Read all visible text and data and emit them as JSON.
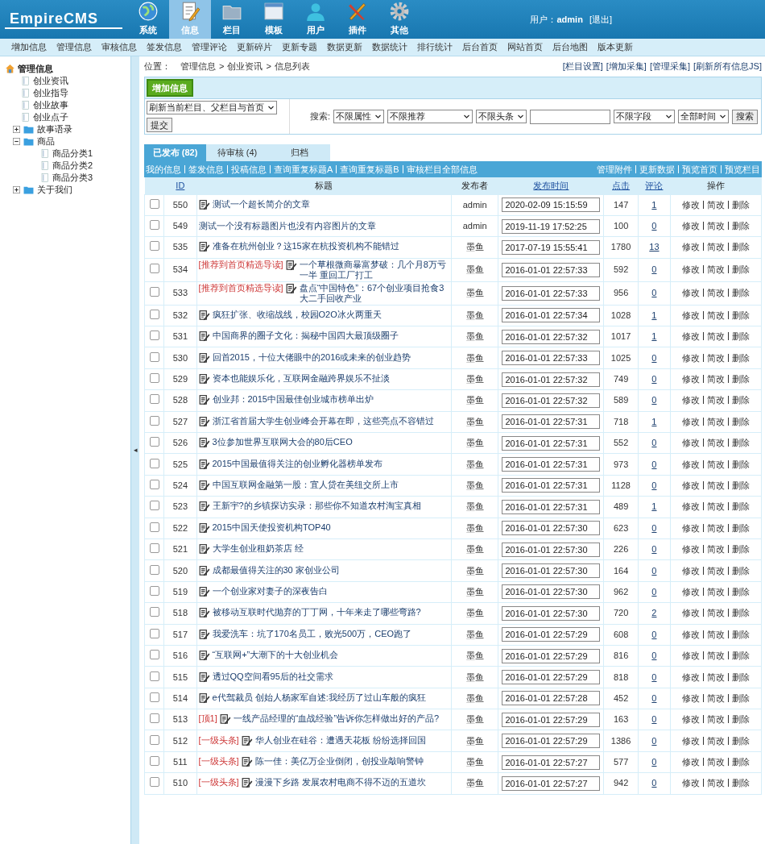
{
  "header": {
    "logo": "EmpireCMS",
    "nav": [
      {
        "label": "系统",
        "selected": false
      },
      {
        "label": "信息",
        "selected": true
      },
      {
        "label": "栏目",
        "selected": false
      },
      {
        "label": "模板",
        "selected": false
      },
      {
        "label": "用户",
        "selected": false
      },
      {
        "label": "插件",
        "selected": false
      },
      {
        "label": "其他",
        "selected": false
      }
    ],
    "user_label": "用户：",
    "user": "admin",
    "logout": "[退出]"
  },
  "submenu": [
    "增加信息",
    "管理信息",
    "审核信息",
    "签发信息",
    "管理评论",
    "更新碎片",
    "更新专题",
    "数据更新",
    "数据统计",
    "排行统计",
    "后台首页",
    "网站首页",
    "后台地图",
    "版本更新"
  ],
  "tree": {
    "label": "管理信息",
    "children": [
      {
        "label": "创业资讯",
        "kind": "page"
      },
      {
        "label": "创业指导",
        "kind": "page"
      },
      {
        "label": "创业故事",
        "kind": "page"
      },
      {
        "label": "创业点子",
        "kind": "page"
      },
      {
        "label": "故事语录",
        "kind": "folder",
        "expanded": false
      },
      {
        "label": "商品",
        "kind": "folder",
        "expanded": true,
        "children": [
          {
            "label": "商品分类1",
            "kind": "page"
          },
          {
            "label": "商品分类2",
            "kind": "page"
          },
          {
            "label": "商品分类3",
            "kind": "page"
          }
        ]
      },
      {
        "label": "关于我们",
        "kind": "folder",
        "expanded": false
      }
    ]
  },
  "splitter": "◂",
  "breadcrumb": {
    "label": "位置：",
    "links": [
      "管理信息",
      "创业资讯"
    ],
    "separators": [
      ">",
      ">"
    ],
    "current": "信息列表"
  },
  "top_links": [
    "[栏目设置]",
    "[增加采集]",
    "[管理采集]",
    "[刷新所有信息JS]"
  ],
  "add_button": "增加信息",
  "refresh_select": "刷新当前栏目、父栏目与首页",
  "submit": "提交",
  "search": {
    "label": "搜索:",
    "selects": [
      "不限属性",
      "不限推荐",
      "不限头条"
    ],
    "field_select": "不限字段",
    "time_select": "全部时间",
    "button": "搜索"
  },
  "tabs": [
    {
      "label": "已发布 (82)",
      "selected": true
    },
    {
      "label": "待审核 (4)",
      "selected": false
    },
    {
      "label": "归档",
      "selected": false
    }
  ],
  "links_left": [
    "我的信息",
    "签发信息",
    "投稿信息",
    "查询重复标题A",
    "查询重复标题B",
    "审核栏目全部信息"
  ],
  "links_right": [
    "管理附件",
    "更新数据",
    "预览首页",
    "预览栏目"
  ],
  "columns": [
    {
      "label": "ID",
      "link": true
    },
    {
      "label": "标题",
      "link": false
    },
    {
      "label": "发布者",
      "link": false
    },
    {
      "label": "发布时间",
      "link": true
    },
    {
      "label": "点击",
      "link": true
    },
    {
      "label": "评论",
      "link": true
    },
    {
      "label": "操作",
      "link": false
    }
  ],
  "rows": [
    {
      "id": "550",
      "title": "测试一个超长简介的文章",
      "icon": true,
      "author": "admin",
      "time": "2020-02-09 15:15:59",
      "clicks": "147",
      "comments": "1",
      "checked": false,
      "actions": [
        "修改",
        "简改",
        "删除"
      ]
    },
    {
      "id": "549",
      "title": "测试一个没有标题图片也没有内容图片的文章",
      "icon": false,
      "author": "admin",
      "time": "2019-11-19 17:52:25",
      "clicks": "100",
      "comments": "0",
      "checked": false,
      "actions": [
        "修改",
        "简改",
        "删除"
      ]
    },
    {
      "id": "535",
      "title": "准备在杭州创业？这15家在杭投资机构不能错过",
      "icon": true,
      "author": "墨鱼",
      "time": "2017-07-19 15:55:41",
      "clicks": "1780",
      "comments": "13",
      "checked": false,
      "actions": [
        "修改",
        "简改",
        "删除"
      ]
    },
    {
      "id": "534",
      "flag": "[推荐到首页精选导读]",
      "title": "一个草根微商暴富梦破：几个月8万亏一半 重回工厂打工",
      "icon": true,
      "author": "墨鱼",
      "time": "2016-01-01 22:57:33",
      "clicks": "592",
      "comments": "0",
      "checked": false,
      "actions": [
        "修改",
        "简改",
        "删除"
      ]
    },
    {
      "id": "533",
      "flag": "[推荐到首页精选导读]",
      "title": "盘点“中国特色”：67个创业项目抢食3大二手回收产业",
      "icon": true,
      "author": "墨鱼",
      "time": "2016-01-01 22:57:33",
      "clicks": "956",
      "comments": "0",
      "checked": false,
      "actions": [
        "修改",
        "简改",
        "删除"
      ]
    },
    {
      "id": "532",
      "title": "疯狂扩张、收缩战线，校园O2O冰火两重天",
      "icon": true,
      "author": "墨鱼",
      "time": "2016-01-01 22:57:34",
      "clicks": "1028",
      "comments": "1",
      "checked": false,
      "actions": [
        "修改",
        "简改",
        "删除"
      ]
    },
    {
      "id": "531",
      "title": "中国商界的圈子文化：揭秘中国四大最顶级圈子",
      "icon": true,
      "author": "墨鱼",
      "time": "2016-01-01 22:57:32",
      "clicks": "1017",
      "comments": "1",
      "checked": false,
      "actions": [
        "修改",
        "简改",
        "删除"
      ]
    },
    {
      "id": "530",
      "title": "回首2015，十位大佬眼中的2016或未来的创业趋势",
      "icon": true,
      "author": "墨鱼",
      "time": "2016-01-01 22:57:33",
      "clicks": "1025",
      "comments": "0",
      "checked": false,
      "actions": [
        "修改",
        "简改",
        "删除"
      ]
    },
    {
      "id": "529",
      "title": "资本也能娱乐化，互联网金融跨界娱乐不扯淡",
      "icon": true,
      "author": "墨鱼",
      "time": "2016-01-01 22:57:32",
      "clicks": "749",
      "comments": "0",
      "checked": false,
      "actions": [
        "修改",
        "简改",
        "删除"
      ]
    },
    {
      "id": "528",
      "title": "创业邦：2015中国最佳创业城市榜单出炉",
      "icon": true,
      "author": "墨鱼",
      "time": "2016-01-01 22:57:32",
      "clicks": "589",
      "comments": "0",
      "checked": false,
      "actions": [
        "修改",
        "简改",
        "删除"
      ]
    },
    {
      "id": "527",
      "title": "浙江省首届大学生创业峰会开幕在即，这些亮点不容错过",
      "icon": true,
      "author": "墨鱼",
      "time": "2016-01-01 22:57:31",
      "clicks": "718",
      "comments": "1",
      "checked": false,
      "actions": [
        "修改",
        "简改",
        "删除"
      ]
    },
    {
      "id": "526",
      "title": "3位参加世界互联网大会的80后CEO",
      "icon": true,
      "author": "墨鱼",
      "time": "2016-01-01 22:57:31",
      "clicks": "552",
      "comments": "0",
      "checked": false,
      "actions": [
        "修改",
        "简改",
        "删除"
      ]
    },
    {
      "id": "525",
      "title": "2015中国最值得关注的创业孵化器榜单发布",
      "icon": true,
      "author": "墨鱼",
      "time": "2016-01-01 22:57:31",
      "clicks": "973",
      "comments": "0",
      "checked": false,
      "actions": [
        "修改",
        "简改",
        "删除"
      ]
    },
    {
      "id": "524",
      "title": "中国互联网金融第一股：宜人贷在美纽交所上市",
      "icon": true,
      "author": "墨鱼",
      "time": "2016-01-01 22:57:31",
      "clicks": "1128",
      "comments": "0",
      "checked": false,
      "actions": [
        "修改",
        "简改",
        "删除"
      ]
    },
    {
      "id": "523",
      "title": "王新宇?的乡镇探访实录：那些你不知道农村淘宝真相",
      "icon": true,
      "author": "墨鱼",
      "time": "2016-01-01 22:57:31",
      "clicks": "489",
      "comments": "1",
      "checked": false,
      "actions": [
        "修改",
        "简改",
        "删除"
      ]
    },
    {
      "id": "522",
      "title": "2015中国天使投资机构TOP40",
      "icon": true,
      "author": "墨鱼",
      "time": "2016-01-01 22:57:30",
      "clicks": "623",
      "comments": "0",
      "checked": false,
      "actions": [
        "修改",
        "简改",
        "删除"
      ]
    },
    {
      "id": "521",
      "title": "大学生创业租奶茶店 经",
      "icon": true,
      "author": "墨鱼",
      "time": "2016-01-01 22:57:30",
      "clicks": "226",
      "comments": "0",
      "checked": false,
      "actions": [
        "修改",
        "简改",
        "删除"
      ]
    },
    {
      "id": "520",
      "title": "成都最值得关注的30 家创业公司",
      "icon": true,
      "author": "墨鱼",
      "time": "2016-01-01 22:57:30",
      "clicks": "164",
      "comments": "0",
      "checked": false,
      "actions": [
        "修改",
        "简改",
        "删除"
      ]
    },
    {
      "id": "519",
      "title": "一个创业家对妻子的深夜告白",
      "icon": true,
      "author": "墨鱼",
      "time": "2016-01-01 22:57:30",
      "clicks": "962",
      "comments": "0",
      "checked": false,
      "actions": [
        "修改",
        "简改",
        "删除"
      ]
    },
    {
      "id": "518",
      "title": "被移动互联时代抛弃的丁丁网，十年来走了哪些弯路?",
      "icon": true,
      "author": "墨鱼",
      "time": "2016-01-01 22:57:30",
      "clicks": "720",
      "comments": "2",
      "checked": false,
      "actions": [
        "修改",
        "简改",
        "删除"
      ]
    },
    {
      "id": "517",
      "title": "我爱洗车：坑了170名员工，败光500万，CEO跑了",
      "icon": true,
      "author": "墨鱼",
      "time": "2016-01-01 22:57:29",
      "clicks": "608",
      "comments": "0",
      "checked": false,
      "actions": [
        "修改",
        "简改",
        "删除"
      ]
    },
    {
      "id": "516",
      "title": "“互联网+”大潮下的十大创业机会",
      "icon": true,
      "author": "墨鱼",
      "time": "2016-01-01 22:57:29",
      "clicks": "816",
      "comments": "0",
      "checked": false,
      "actions": [
        "修改",
        "简改",
        "删除"
      ]
    },
    {
      "id": "515",
      "title": "透过QQ空间看95后的社交需求",
      "icon": true,
      "author": "墨鱼",
      "time": "2016-01-01 22:57:29",
      "clicks": "818",
      "comments": "0",
      "checked": false,
      "actions": [
        "修改",
        "简改",
        "删除"
      ]
    },
    {
      "id": "514",
      "title": "e代驾裁员 创始人杨家军自述:我经历了过山车般的疯狂",
      "icon": true,
      "author": "墨鱼",
      "time": "2016-01-01 22:57:28",
      "clicks": "452",
      "comments": "0",
      "checked": false,
      "actions": [
        "修改",
        "简改",
        "删除"
      ]
    },
    {
      "id": "513",
      "flag": "[顶1]",
      "title": "一线产品经理的“血战经验”告诉你怎样做出好的产品?",
      "icon": true,
      "author": "墨鱼",
      "time": "2016-01-01 22:57:29",
      "clicks": "163",
      "comments": "0",
      "checked": false,
      "actions": [
        "修改",
        "简改",
        "删除"
      ]
    },
    {
      "id": "512",
      "flag": "[一级头条]",
      "title": "华人创业在硅谷：遭遇天花板 纷纷选择回国",
      "icon": true,
      "author": "墨鱼",
      "time": "2016-01-01 22:57:29",
      "clicks": "1386",
      "comments": "0",
      "checked": false,
      "actions": [
        "修改",
        "简改",
        "删除"
      ]
    },
    {
      "id": "511",
      "flag": "[一级头条]",
      "title": "陈一佳：美亿万企业倒闭，创投业敲响警钟",
      "icon": true,
      "author": "墨鱼",
      "time": "2016-01-01 22:57:27",
      "clicks": "577",
      "comments": "0",
      "checked": false,
      "actions": [
        "修改",
        "简改",
        "删除"
      ]
    },
    {
      "id": "510",
      "flag": "[一级头条]",
      "title": "漫漫下乡路 发展农村电商不得不迈的五道坎",
      "icon": true,
      "author": "墨鱼",
      "time": "2016-01-01 22:57:27",
      "clicks": "942",
      "comments": "0",
      "checked": false,
      "actions": [
        "修改",
        "简改",
        "删除"
      ]
    }
  ]
}
